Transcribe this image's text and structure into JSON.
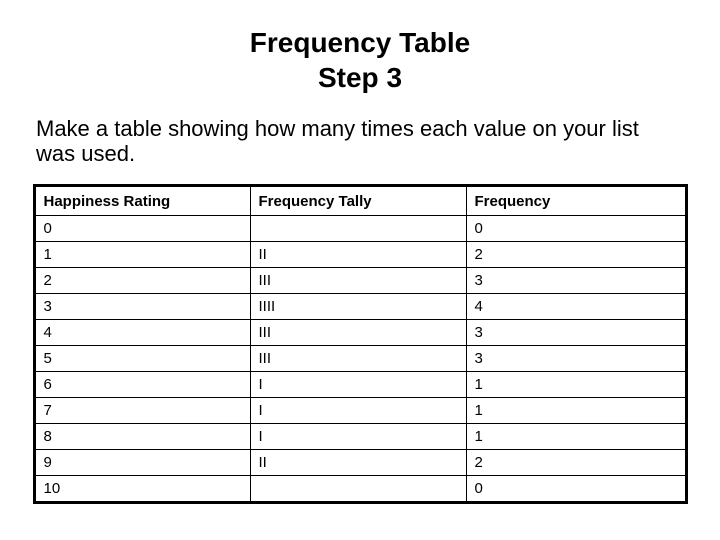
{
  "title": "Frequency Table",
  "subtitle": "Step 3",
  "instruction": "Make a table showing how many times each value on your list was used.",
  "table": {
    "headers": [
      "Happiness Rating",
      "Frequency Tally",
      "Frequency"
    ],
    "rows": [
      {
        "rating": "0",
        "tally": "",
        "freq": "0"
      },
      {
        "rating": "1",
        "tally": "II",
        "freq": "2"
      },
      {
        "rating": "2",
        "tally": "III",
        "freq": "3"
      },
      {
        "rating": "3",
        "tally": "IIII",
        "freq": "4"
      },
      {
        "rating": "4",
        "tally": "III",
        "freq": "3"
      },
      {
        "rating": "5",
        "tally": "III",
        "freq": "3"
      },
      {
        "rating": "6",
        "tally": "I",
        "freq": "1"
      },
      {
        "rating": "7",
        "tally": "I",
        "freq": "1"
      },
      {
        "rating": "8",
        "tally": "I",
        "freq": "1"
      },
      {
        "rating": "9",
        "tally": "II",
        "freq": "2"
      },
      {
        "rating": "10",
        "tally": "",
        "freq": "0"
      }
    ]
  },
  "chart_data": {
    "type": "table",
    "title": "Frequency Table",
    "columns": [
      "Happiness Rating",
      "Frequency Tally",
      "Frequency"
    ],
    "rows": [
      [
        "0",
        "",
        0
      ],
      [
        "1",
        "II",
        2
      ],
      [
        "2",
        "III",
        3
      ],
      [
        "3",
        "IIII",
        4
      ],
      [
        "4",
        "III",
        3
      ],
      [
        "5",
        "III",
        3
      ],
      [
        "6",
        "I",
        1
      ],
      [
        "7",
        "I",
        1
      ],
      [
        "8",
        "I",
        1
      ],
      [
        "9",
        "II",
        2
      ],
      [
        "10",
        "",
        0
      ]
    ]
  }
}
